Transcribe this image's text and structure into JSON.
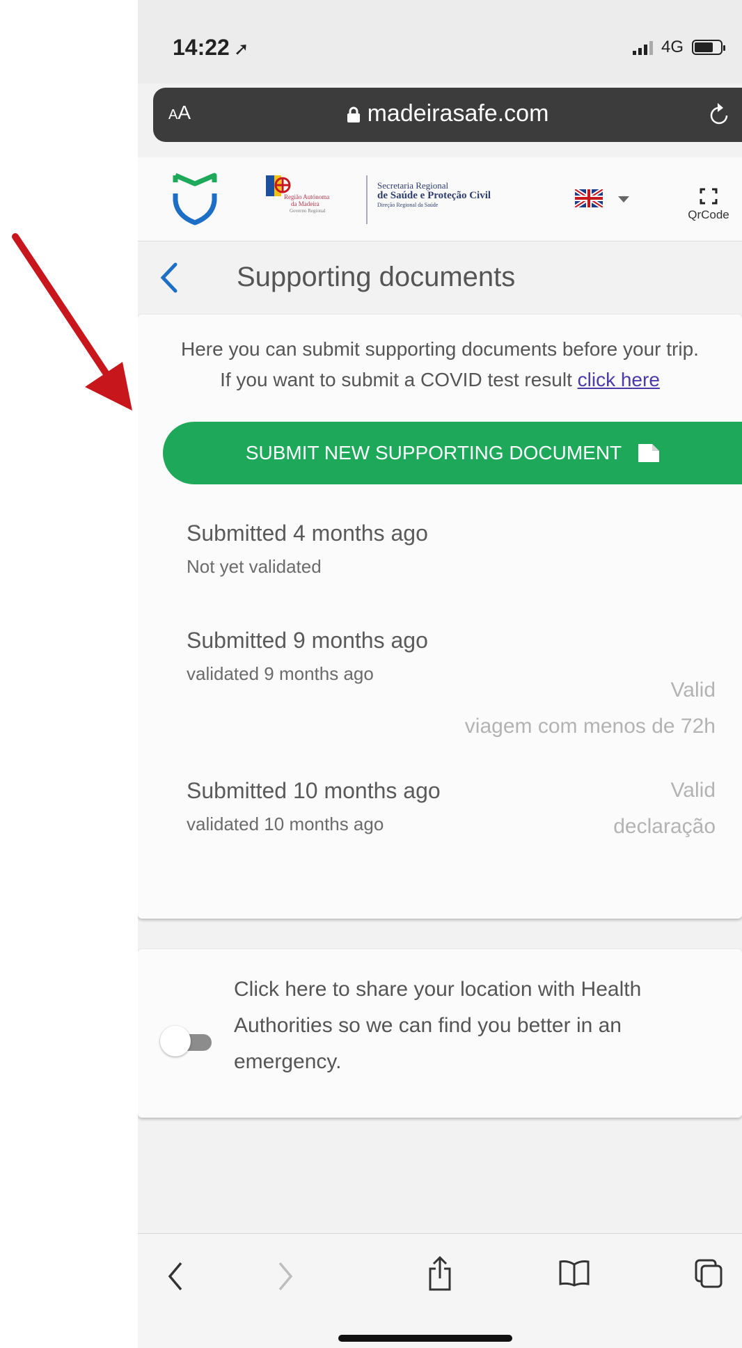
{
  "status_bar": {
    "time": "14:22",
    "network": "4G"
  },
  "browser": {
    "text_size_label": "AA",
    "url": "madeirasafe.com"
  },
  "site_header": {
    "region_logo_line1": "Região Autónoma",
    "region_logo_line2": "da Madeira",
    "region_logo_line3": "Governo Regional",
    "secretariat_line1": "Secretaria Regional",
    "secretariat_line2": "de Saúde e Proteção Civil",
    "secretariat_line3": "Direção Regional da Saúde",
    "qr_label": "QrCode"
  },
  "page": {
    "title": "Supporting documents"
  },
  "intro": {
    "line1": "Here you can submit supporting documents before your trip.",
    "line2_prefix": "If you want to submit a COVID test result",
    "link_text": "click here"
  },
  "submit_button": {
    "label": "SUBMIT NEW SUPPORTING DOCUMENT"
  },
  "documents": [
    {
      "title": "Submitted 4 months ago",
      "status": "Not yet validated",
      "validity": "",
      "type": ""
    },
    {
      "title": "Submitted 9 months ago",
      "status": "validated 9 months ago",
      "validity": "Valid",
      "type": "viagem com menos de 72h"
    },
    {
      "title": "Submitted 10 months ago",
      "status": "validated 10 months ago",
      "validity": "Valid",
      "type": "declaração"
    }
  ],
  "location_share": {
    "text": "Click here to share your location with Health Authorities so we can find you better in an emergency.",
    "enabled": false
  },
  "colors": {
    "primary_green": "#1ea85a",
    "annotation_arrow": "#c8161d",
    "link": "#4b3aa8"
  }
}
